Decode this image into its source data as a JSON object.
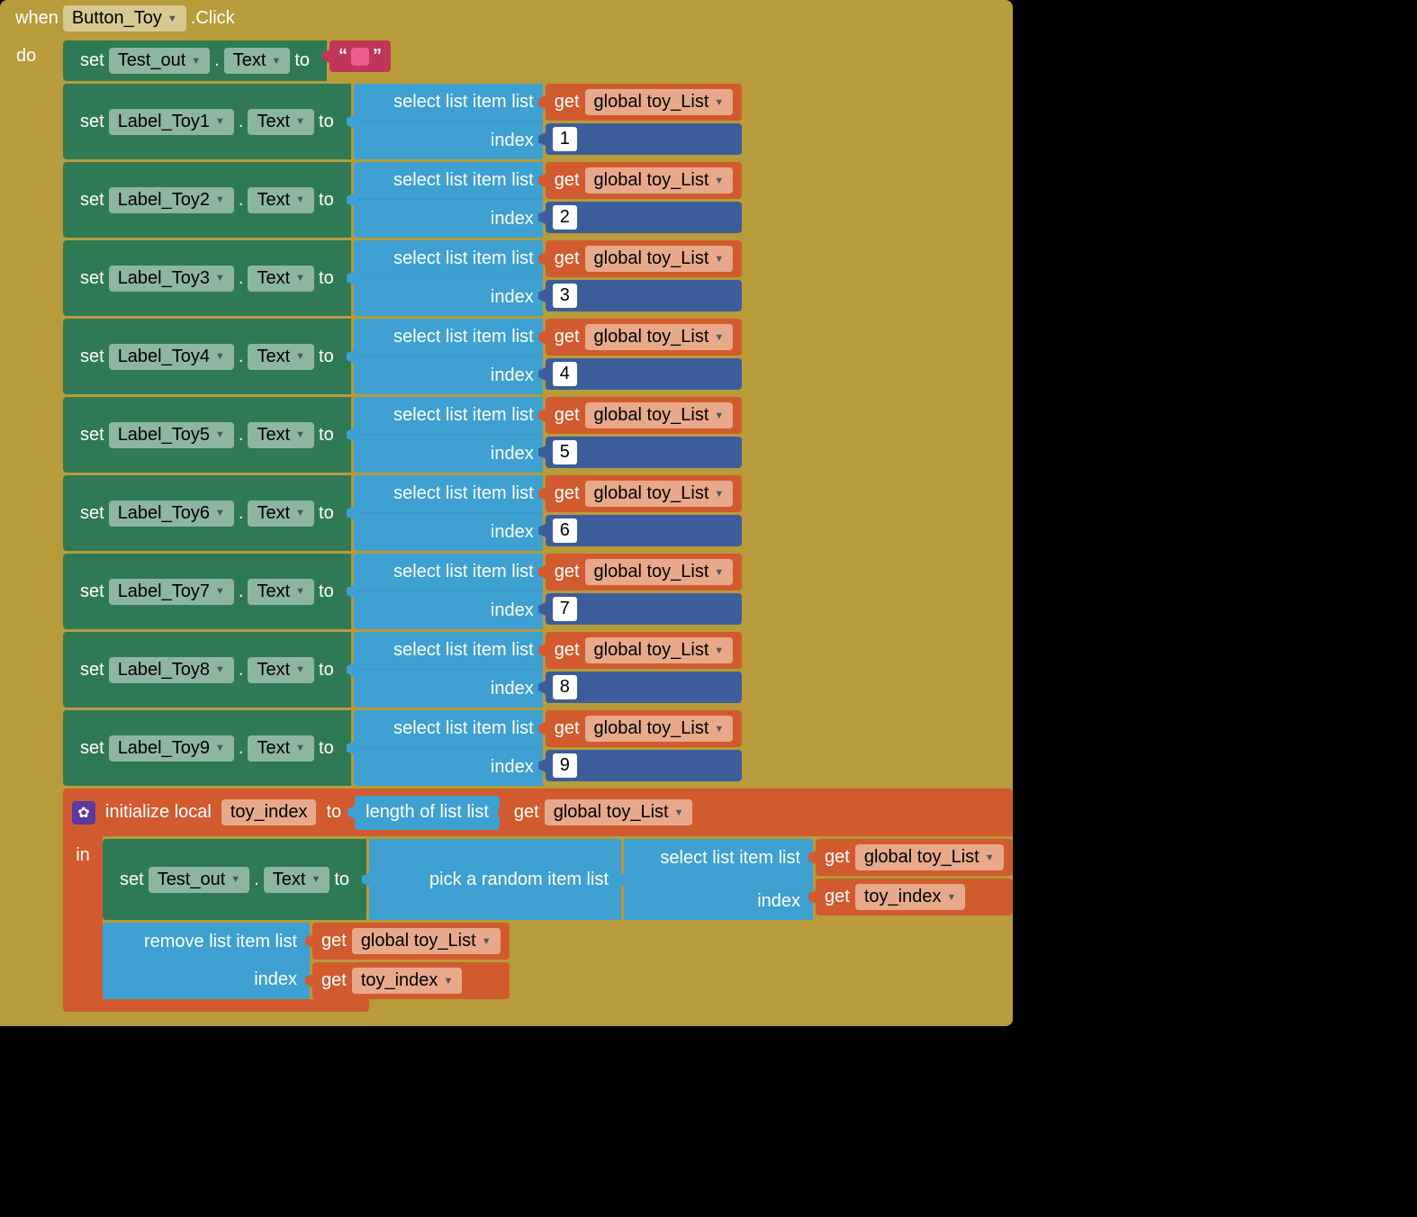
{
  "when": {
    "kw_when": "when",
    "component": "Button_Toy",
    "event": ".Click",
    "kw_do": "do"
  },
  "rows": [
    {
      "kw_set": "set",
      "comp": "Test_out",
      "prop": "Text",
      "kw_to": "to",
      "type": "textlit",
      "text_value": ""
    },
    {
      "kw_set": "set",
      "comp": "Label_Toy1",
      "prop": "Text",
      "kw_to": "to",
      "type": "sli",
      "sli_list_lbl": "select list item  list",
      "sli_index_lbl": "index",
      "index": "1",
      "get_kw": "get",
      "get_var": "global toy_List"
    },
    {
      "kw_set": "set",
      "comp": "Label_Toy2",
      "prop": "Text",
      "kw_to": "to",
      "type": "sli",
      "sli_list_lbl": "select list item  list",
      "sli_index_lbl": "index",
      "index": "2",
      "get_kw": "get",
      "get_var": "global toy_List"
    },
    {
      "kw_set": "set",
      "comp": "Label_Toy3",
      "prop": "Text",
      "kw_to": "to",
      "type": "sli",
      "sli_list_lbl": "select list item  list",
      "sli_index_lbl": "index",
      "index": "3",
      "get_kw": "get",
      "get_var": "global toy_List"
    },
    {
      "kw_set": "set",
      "comp": "Label_Toy4",
      "prop": "Text",
      "kw_to": "to",
      "type": "sli",
      "sli_list_lbl": "select list item  list",
      "sli_index_lbl": "index",
      "index": "4",
      "get_kw": "get",
      "get_var": "global toy_List"
    },
    {
      "kw_set": "set",
      "comp": "Label_Toy5",
      "prop": "Text",
      "kw_to": "to",
      "type": "sli",
      "sli_list_lbl": "select list item  list",
      "sli_index_lbl": "index",
      "index": "5",
      "get_kw": "get",
      "get_var": "global toy_List"
    },
    {
      "kw_set": "set",
      "comp": "Label_Toy6",
      "prop": "Text",
      "kw_to": "to",
      "type": "sli",
      "sli_list_lbl": "select list item  list",
      "sli_index_lbl": "index",
      "index": "6",
      "get_kw": "get",
      "get_var": "global toy_List"
    },
    {
      "kw_set": "set",
      "comp": "Label_Toy7",
      "prop": "Text",
      "kw_to": "to",
      "type": "sli",
      "sli_list_lbl": "select list item  list",
      "sli_index_lbl": "index",
      "index": "7",
      "get_kw": "get",
      "get_var": "global toy_List"
    },
    {
      "kw_set": "set",
      "comp": "Label_Toy8",
      "prop": "Text",
      "kw_to": "to",
      "type": "sli",
      "sli_list_lbl": "select list item  list",
      "sli_index_lbl": "index",
      "index": "8",
      "get_kw": "get",
      "get_var": "global toy_List"
    },
    {
      "kw_set": "set",
      "comp": "Label_Toy9",
      "prop": "Text",
      "kw_to": "to",
      "type": "sli",
      "sli_list_lbl": "select list item  list",
      "sli_index_lbl": "index",
      "index": "9",
      "get_kw": "get",
      "get_var": "global toy_List"
    }
  ],
  "init": {
    "kw_init": "initialize local",
    "var": "toy_index",
    "kw_to": "to",
    "len_lbl": "length of list  list",
    "len_get_kw": "get",
    "len_get_var": "global toy_List",
    "kw_in": "in",
    "set2": {
      "kw_set": "set",
      "comp": "Test_out",
      "prop": "Text",
      "kw_to": "to"
    },
    "pick_lbl": "pick a random item  list",
    "sli_list_lbl": "select list item  list",
    "sli_index_lbl": "index",
    "sli_get_kw": "get",
    "sli_get_var": "global toy_List",
    "sli_index_get_kw": "get",
    "sli_index_get_var": "toy_index",
    "rm_list_lbl": "remove list item  list",
    "rm_index_lbl": "index",
    "rm_get_kw": "get",
    "rm_get_var": "global toy_List",
    "rm_idx_get_kw": "get",
    "rm_idx_get_var": "toy_index"
  }
}
